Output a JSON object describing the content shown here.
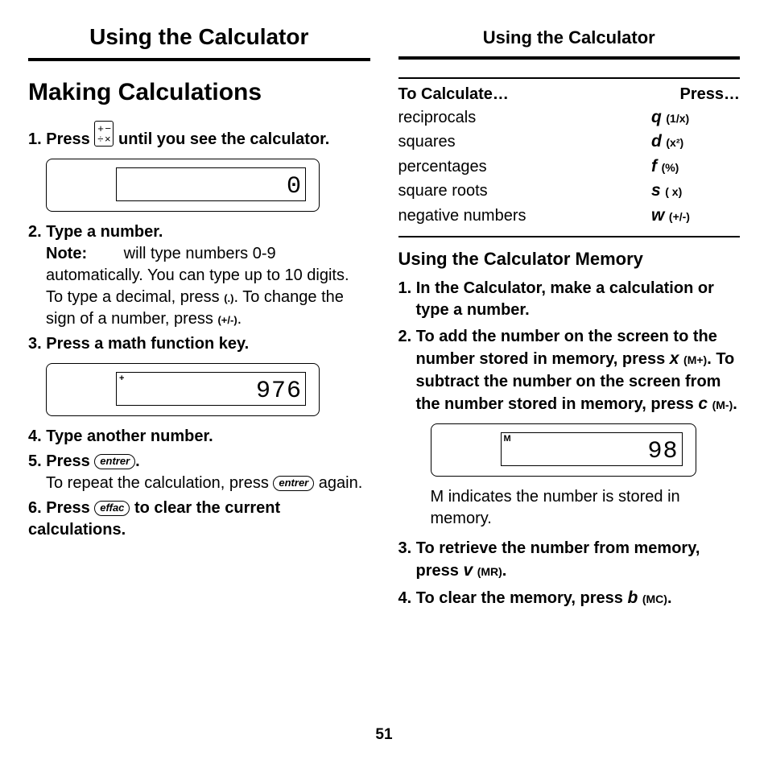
{
  "left": {
    "title": "Using the Calculator",
    "heading": "Making Calculations",
    "step1_a": "1. Press ",
    "step1_b": " until you see the calculator.",
    "screen1": "0",
    "step2_label": "2. Type a number.",
    "step2_note": "Note:",
    "step2_body_a": " will type numbers 0-9 automatically. You can type up to 10 digits. To type a decimal, press ",
    "step2_dot": "(.)",
    "step2_body_b": ". To change the sign of a number, press ",
    "step2_pm": "(+/-)",
    "step2_body_c": ".",
    "step3": "3. Press a math function key.",
    "screen2_sym": "+",
    "screen2": "976",
    "step4": "4. Type another number.",
    "step5_a": "5. Press ",
    "step5_key": "entrer",
    "step5_b": ".",
    "step5_body_a": "To repeat the calculation, press ",
    "step5_body_b": " again.",
    "step6_a": "6. Press ",
    "step6_key": "effac",
    "step6_b": " to clear the current calculations."
  },
  "right": {
    "title": "Using the Calculator",
    "table_h1": "To Calculate…",
    "table_h2": "Press…",
    "rows": [
      {
        "label": "reciprocals",
        "key": "q",
        "sym": "(1/x)"
      },
      {
        "label": "squares",
        "key": "d",
        "sym": "(x²)"
      },
      {
        "label": "percentages",
        "key": "f",
        "sym": "(%)"
      },
      {
        "label": "square roots",
        "key": "s",
        "sym": "(  x)"
      },
      {
        "label": "negative numbers",
        "key": "w",
        "sym": "(+/-)"
      }
    ],
    "mem_heading": "Using the Calculator Memory",
    "mem1": "1. In the Calculator, make a calculation or type a number.",
    "mem2_a": "2. To add the number on the screen to the number stored in memory, press ",
    "mem2_key1": "x",
    "mem2_sym1": "(M+)",
    "mem2_b": ". To subtract the number on the screen from the number stored in memory, press ",
    "mem2_key2": "c",
    "mem2_sym2": "(M-)",
    "mem2_c": ".",
    "screen3_sym": "M",
    "screen3": "98",
    "screen3_caption": "M indicates the number is stored in memory.",
    "mem3_a": "3. To retrieve the number from memory, press ",
    "mem3_key": "v",
    "mem3_sym": "(MR)",
    "mem3_b": ".",
    "mem4_a": "4. To clear the memory, press ",
    "mem4_key": "b",
    "mem4_sym": "(MC)",
    "mem4_b": "."
  },
  "page_number": "51"
}
